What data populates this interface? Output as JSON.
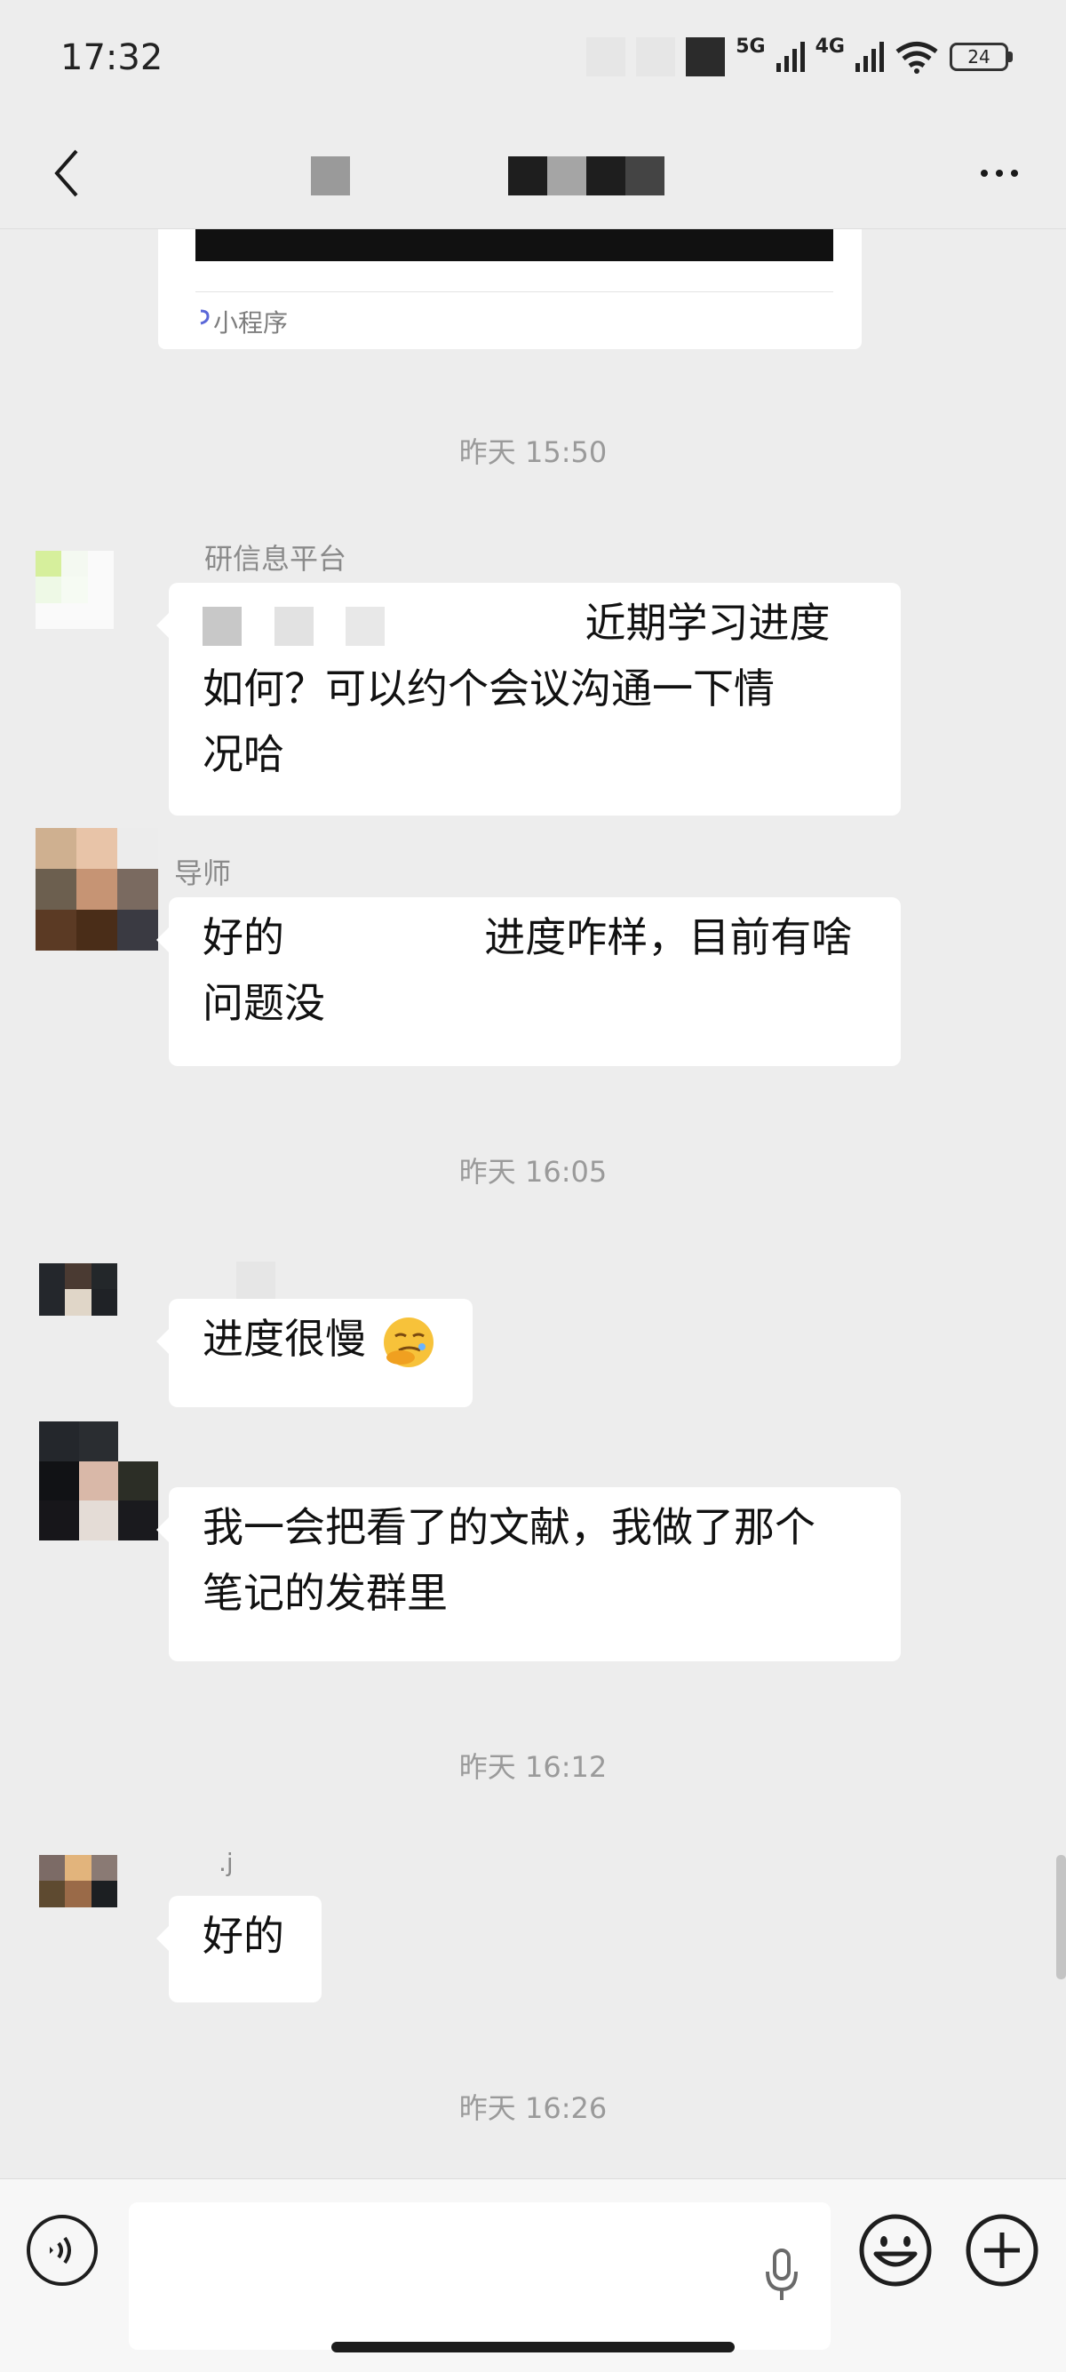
{
  "status_bar": {
    "time": "17:32",
    "network_1": "5G",
    "network_2": "4G",
    "battery": "24"
  },
  "mini_program": {
    "label": "小程序"
  },
  "timestamps": [
    "昨天 15:50",
    "昨天 16:05",
    "昨天 16:12",
    "昨天 16:26"
  ],
  "messages": [
    {
      "sender": "研信息平台",
      "text_1": "近期学习进度",
      "text_2": "如何？可以约个会议沟通一下情",
      "text_3": "况哈"
    },
    {
      "sender": "导师",
      "text_1": "好的",
      "text_2": "进度咋样，目前有啥",
      "text_3": "问题没"
    },
    {
      "sender": "",
      "text_1": "进度很慢"
    },
    {
      "sender": "",
      "text_1": "我一会把看了的文献，我做了那个",
      "text_2": "笔记的发群里"
    },
    {
      "sender": ".j",
      "text_1": "好的"
    }
  ],
  "colors": {
    "background": "#ededed",
    "bubble": "#ffffff",
    "timestamp": "#9a9a9a"
  }
}
